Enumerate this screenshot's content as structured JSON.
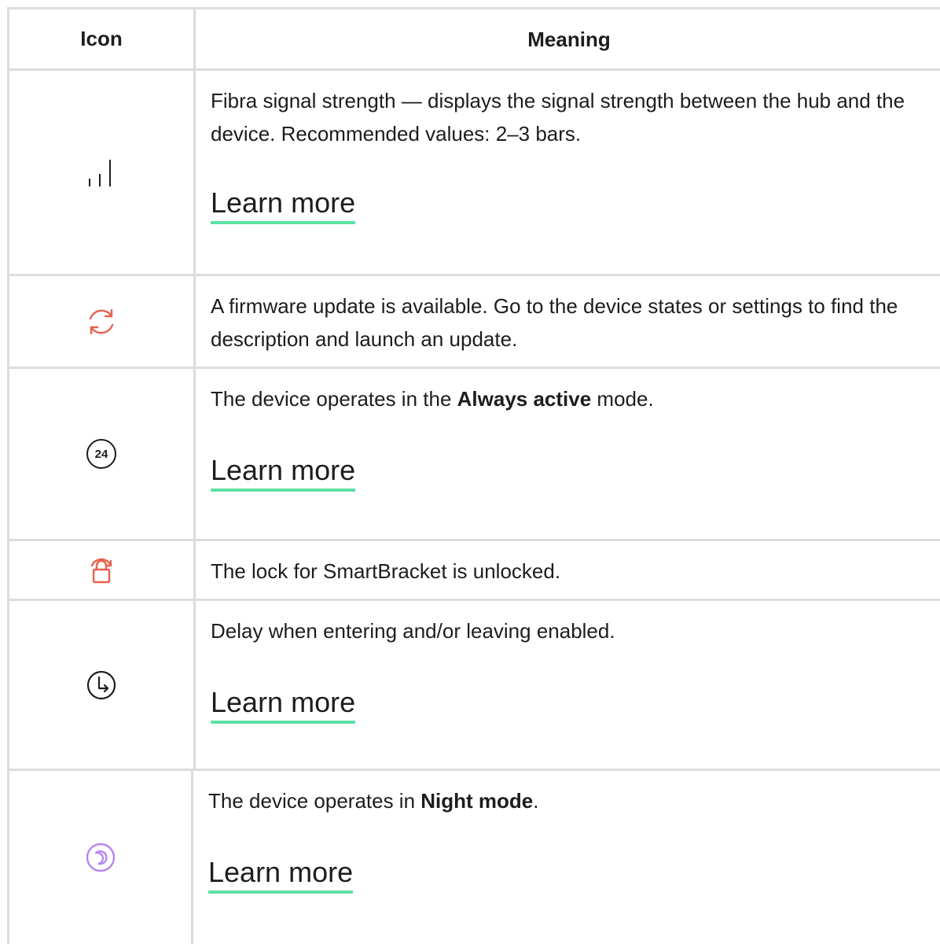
{
  "table": {
    "header": {
      "icon": "Icon",
      "meaning": "Meaning"
    },
    "rows": [
      {
        "icon": "signal-strength-icon",
        "text": "Fibra signal strength — displays the signal strength between the hub and the device. Recommended values: 2–3 bars.",
        "link": "Learn more"
      },
      {
        "icon": "firmware-update-icon",
        "text": "A firmware update is available. Go to the device states or settings to find the description and launch an update."
      },
      {
        "icon": "always-active-24-icon",
        "icon_text": "24",
        "text_before": "The device operates in the ",
        "text_bold": "Always active",
        "text_after": " mode.",
        "link": "Learn more"
      },
      {
        "icon": "unlocked-lock-icon",
        "text": "The lock for SmartBracket is unlocked."
      },
      {
        "icon": "delay-clock-icon",
        "text": "Delay when entering and/or leaving enabled.",
        "link": "Learn more"
      },
      {
        "icon": "night-mode-icon",
        "text_before": "The device operates in ",
        "text_bold": "Night mode",
        "text_after": ".",
        "link": "Learn more"
      }
    ]
  },
  "colors": {
    "border": "#dcdcdc",
    "link_underline": "#5ce1a3",
    "alert_icon": "#e8604c",
    "night_icon": "#b487f0",
    "text": "#1d1d1d"
  }
}
